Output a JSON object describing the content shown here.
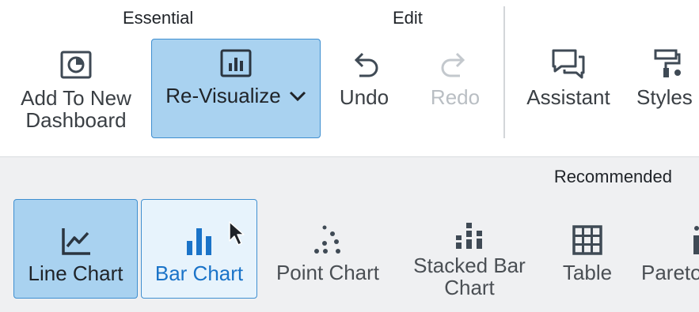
{
  "toolbar": {
    "groups": {
      "essential": "Essential",
      "edit": "Edit"
    },
    "buttons": {
      "add_to_dashboard": {
        "line1": "Add To New",
        "line2": "Dashboard"
      },
      "revisualize": "Re-Visualize",
      "undo": "Undo",
      "redo": "Redo",
      "assistant": "Assistant",
      "styles": "Styles"
    }
  },
  "ribbon": {
    "section_label": "Recommended",
    "charts": {
      "line": "Line Chart",
      "bar": "Bar Chart",
      "point": "Point Chart",
      "stacked_bar": {
        "line1": "Stacked Bar",
        "line2": "Chart"
      },
      "table": "Table",
      "pareto": "Pareto"
    }
  },
  "colors": {
    "selected_bg": "#a9d2f0",
    "selected_border": "#3f8fd0",
    "hover_bg": "#e7f3fc",
    "accent_blue": "#1a73c8",
    "icon_dark": "#3f4a55",
    "disabled": "#b9bec3",
    "ribbon_bg": "#eff0f2"
  }
}
